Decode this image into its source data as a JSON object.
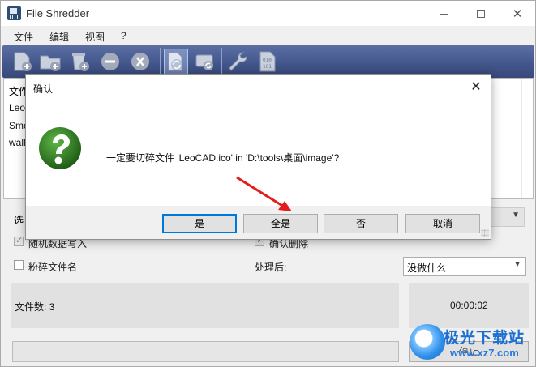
{
  "window": {
    "title": "File Shredder",
    "controls": {
      "minimize": "—",
      "maximize": "☐",
      "close": "✕"
    }
  },
  "menu": [
    "文件",
    "编辑",
    "视图",
    "?"
  ],
  "toolbar": {
    "icons": [
      "add-file-icon",
      "add-folder-icon",
      "add-recycle-bin-icon",
      "remove-icon",
      "remove-all-icon",
      "shred-icon",
      "shred-disk-icon",
      "settings-wrench-icon",
      "binary-icon"
    ]
  },
  "file_list": {
    "header": "文件",
    "rows": [
      "Leo",
      "Smo",
      "wall"
    ]
  },
  "options": {
    "method_label": "选",
    "random_data_label": "随机数据写入",
    "confirm_delete_label": "确认删除",
    "shred_filenames_label": "粉碎文件名",
    "after_label": "处理后:",
    "after_value": "没做什么"
  },
  "status": {
    "file_count": "文件数: 3",
    "elapsed": "00:00:02"
  },
  "stop_button": "停止",
  "dialog": {
    "title": "确认",
    "close": "✕",
    "message": "一定要切碎文件 'LeoCAD.ico' in 'D:\\tools\\桌面\\image'?",
    "buttons": {
      "yes": "是",
      "yes_all": "全是",
      "no": "否",
      "cancel": "取消"
    }
  },
  "watermark": {
    "name": "极光下载站",
    "url": "www.xz7.com"
  },
  "colors": {
    "toolbar": "#42558b",
    "dialog_icon": "#2e7a22",
    "default_button_border": "#0078d7",
    "arrow": "#e11d1d"
  }
}
